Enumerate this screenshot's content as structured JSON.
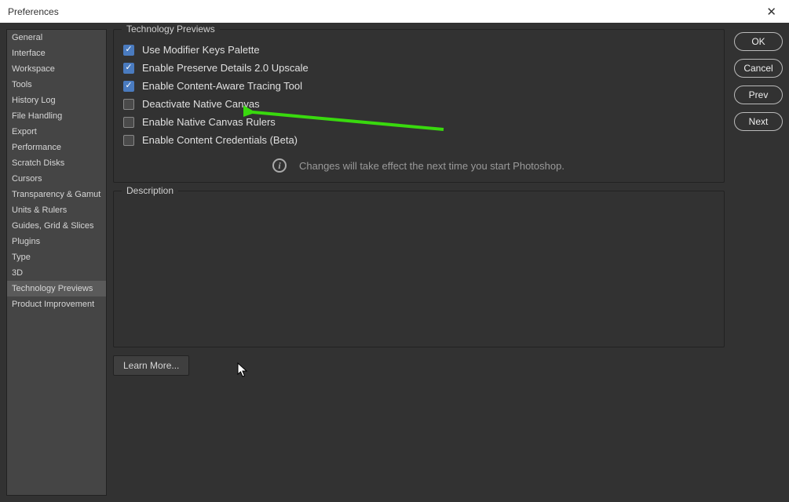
{
  "window": {
    "title": "Preferences"
  },
  "sidebar": {
    "items": [
      {
        "label": "General"
      },
      {
        "label": "Interface"
      },
      {
        "label": "Workspace"
      },
      {
        "label": "Tools"
      },
      {
        "label": "History Log"
      },
      {
        "label": "File Handling"
      },
      {
        "label": "Export"
      },
      {
        "label": "Performance"
      },
      {
        "label": "Scratch Disks"
      },
      {
        "label": "Cursors"
      },
      {
        "label": "Transparency & Gamut"
      },
      {
        "label": "Units & Rulers"
      },
      {
        "label": "Guides, Grid & Slices"
      },
      {
        "label": "Plugins"
      },
      {
        "label": "Type"
      },
      {
        "label": "3D"
      },
      {
        "label": "Technology Previews",
        "selected": true
      },
      {
        "label": "Product Improvement"
      }
    ]
  },
  "panel": {
    "group_label": "Technology Previews",
    "options": [
      {
        "label": "Use Modifier Keys Palette",
        "checked": true
      },
      {
        "label": "Enable Preserve Details 2.0 Upscale",
        "checked": true
      },
      {
        "label": "Enable Content-Aware Tracing Tool",
        "checked": true
      },
      {
        "label": "Deactivate Native Canvas",
        "checked": false,
        "highlighted": true
      },
      {
        "label": "Enable Native Canvas Rulers",
        "checked": false
      },
      {
        "label": "Enable Content Credentials (Beta)",
        "checked": false
      }
    ],
    "info_text": "Changes will take effect the next time you start Photoshop.",
    "description_label": "Description",
    "learn_more_label": "Learn More..."
  },
  "buttons": {
    "ok": "OK",
    "cancel": "Cancel",
    "prev": "Prev",
    "next": "Next"
  },
  "annotation": {
    "arrow_color": "#39d90e"
  }
}
